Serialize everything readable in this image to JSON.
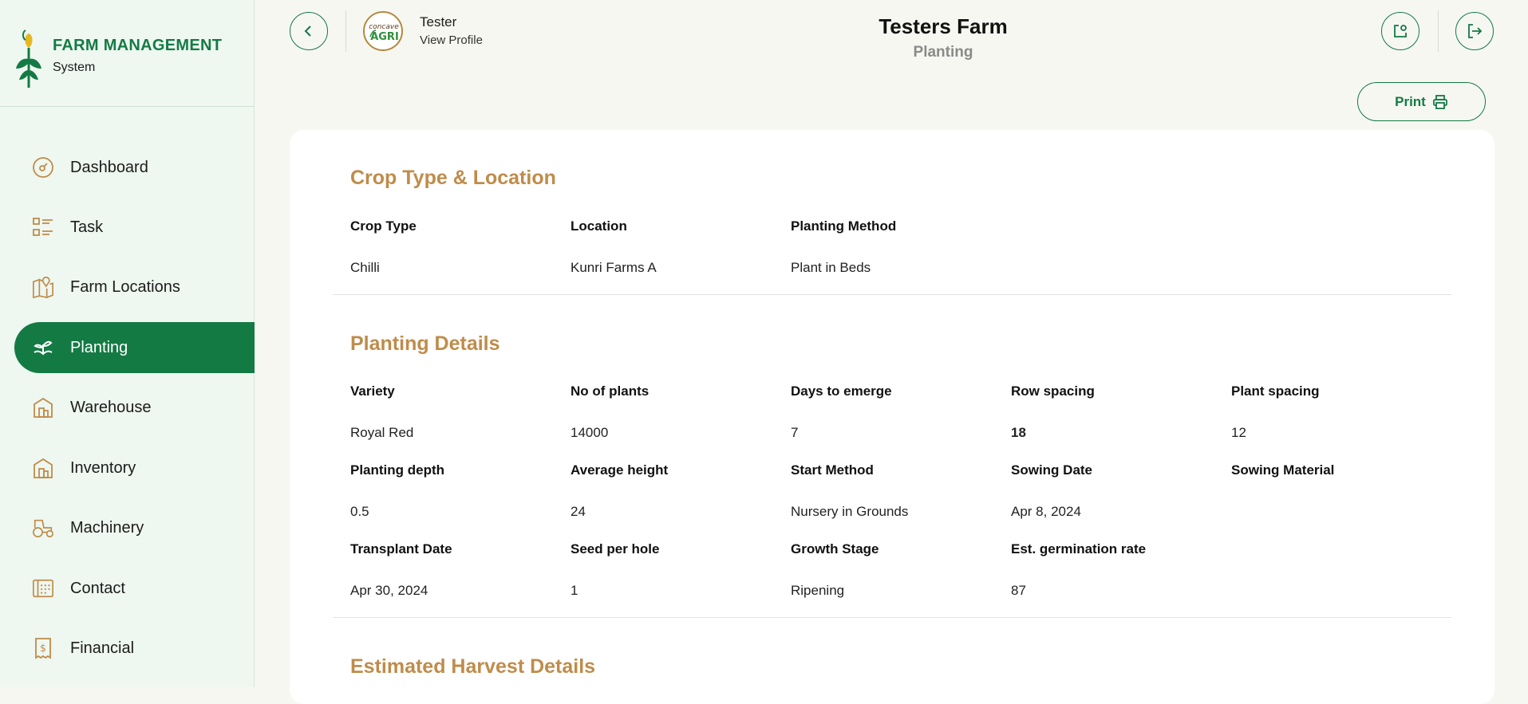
{
  "brand": {
    "title": "FARM MANAGEMENT",
    "subtitle": "System"
  },
  "sidebar": {
    "items": [
      {
        "label": "Dashboard",
        "icon": "dashboard-icon",
        "active": false
      },
      {
        "label": "Task",
        "icon": "task-list-icon",
        "active": false
      },
      {
        "label": "Farm Locations",
        "icon": "map-pin-icon",
        "active": false
      },
      {
        "label": "Planting",
        "icon": "plant-icon",
        "active": true
      },
      {
        "label": "Warehouse",
        "icon": "warehouse-icon",
        "active": false
      },
      {
        "label": "Inventory",
        "icon": "inventory-icon",
        "active": false
      },
      {
        "label": "Machinery",
        "icon": "tractor-icon",
        "active": false
      },
      {
        "label": "Contact",
        "icon": "contact-icon",
        "active": false
      },
      {
        "label": "Financial",
        "icon": "receipt-dollar-icon",
        "active": false
      }
    ]
  },
  "header": {
    "profile_name": "Tester",
    "profile_link": "View Profile",
    "avatar_text_top": "concave",
    "avatar_text_bottom": "AGRI",
    "title": "Testers Farm",
    "subtitle": "Planting",
    "print_label": "Print"
  },
  "colors": {
    "brand_green": "#137a43",
    "section_gold": "#bf8c4a",
    "sidebar_bg": "#eef7f0"
  },
  "crop_section": {
    "title": "Crop Type & Location",
    "fields": [
      {
        "label": "Crop Type",
        "value": "Chilli"
      },
      {
        "label": "Location",
        "value": "Kunri Farms A"
      },
      {
        "label": "Planting Method",
        "value": "Plant in Beds"
      }
    ]
  },
  "planting_section": {
    "title": "Planting Details",
    "rows": [
      [
        {
          "label": "Variety",
          "value": "Royal Red"
        },
        {
          "label": "No of plants",
          "value": "14000"
        },
        {
          "label": "Days to emerge",
          "value": "7"
        },
        {
          "label": "Row spacing",
          "value": "18"
        },
        {
          "label": "Plant spacing",
          "value": "12"
        }
      ],
      [
        {
          "label": "Planting depth",
          "value": "0.5"
        },
        {
          "label": "Average height",
          "value": "24"
        },
        {
          "label": "Start Method",
          "value": "Nursery in Grounds"
        },
        {
          "label": "Sowing Date",
          "value": "Apr 8, 2024"
        },
        {
          "label": "Sowing Material",
          "value": ""
        }
      ],
      [
        {
          "label": "Transplant Date",
          "value": "Apr 30, 2024"
        },
        {
          "label": "Seed per hole",
          "value": "1"
        },
        {
          "label": "Growth Stage",
          "value": "Ripening"
        },
        {
          "label": "Est. germination rate",
          "value": "87"
        }
      ]
    ]
  },
  "harvest_section": {
    "title": "Estimated Harvest Details"
  }
}
